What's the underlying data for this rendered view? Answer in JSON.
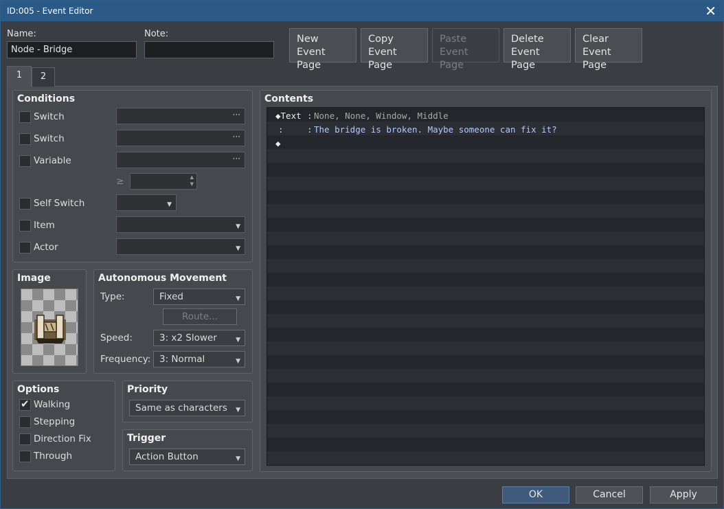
{
  "window": {
    "title": "ID:005 - Event Editor",
    "close_glyph": "✕"
  },
  "header": {
    "name_label": "Name:",
    "name_value": "Node - Bridge",
    "note_label": "Note:",
    "note_value": "",
    "buttons": [
      {
        "line1": "New",
        "line2": "Event Page",
        "enabled": true
      },
      {
        "line1": "Copy",
        "line2": "Event Page",
        "enabled": true
      },
      {
        "line1": "Paste",
        "line2": "Event Page",
        "enabled": false
      },
      {
        "line1": "Delete",
        "line2": "Event Page",
        "enabled": true
      },
      {
        "line1": "Clear",
        "line2": "Event Page",
        "enabled": true
      }
    ]
  },
  "tabs": [
    "1",
    "2"
  ],
  "conditions": {
    "title": "Conditions",
    "switch1": "Switch",
    "switch2": "Switch",
    "variable": "Variable",
    "gte": "≥",
    "self_switch": "Self Switch",
    "item": "Item",
    "actor": "Actor",
    "dots": "···"
  },
  "image": {
    "title": "Image",
    "icon": "bridge-sprite-icon"
  },
  "movement": {
    "title": "Autonomous Movement",
    "type_label": "Type:",
    "type_value": "Fixed",
    "route_label": "Route...",
    "speed_label": "Speed:",
    "speed_value": "3: x2 Slower",
    "freq_label": "Frequency:",
    "freq_value": "3: Normal"
  },
  "options": {
    "title": "Options",
    "walking": "Walking",
    "stepping": "Stepping",
    "direction_fix": "Direction Fix",
    "through": "Through"
  },
  "priority": {
    "title": "Priority",
    "value": "Same as characters"
  },
  "trigger": {
    "title": "Trigger",
    "value": "Action Button"
  },
  "contents": {
    "title": "Contents",
    "line1_cmd": "◆Text",
    "line1_sep": ":",
    "line1_args": "None, None, Window, Middle",
    "line2_lead": ":",
    "line2_sep": ":",
    "line2_text": "The bridge is broken. Maybe someone can fix it?",
    "line3": "◆"
  },
  "footer": {
    "ok": "OK",
    "cancel": "Cancel",
    "apply": "Apply"
  },
  "colors": {
    "titlebar": "#2c5a86",
    "message_text": "#b8c6ff",
    "args_text": "#a8a8a8"
  }
}
